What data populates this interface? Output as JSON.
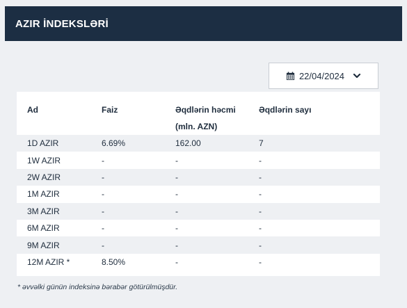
{
  "header": {
    "title": "AZIR İNDEKSLƏRİ"
  },
  "date_picker": {
    "value": "22/04/2024",
    "calendar_icon": "calendar-icon",
    "chevron_icon": "chevron-down-icon"
  },
  "table": {
    "columns": [
      "Ad",
      "Faiz",
      "Əqdlərin həcmi (mln. AZN)",
      "Əqdlərin sayı"
    ],
    "rows": [
      [
        "1D AZIR",
        "6.69%",
        "162.00",
        "7"
      ],
      [
        "1W AZIR",
        "-",
        "-",
        "-"
      ],
      [
        "2W AZIR",
        "-",
        "-",
        "-"
      ],
      [
        "1M AZIR",
        "-",
        "-",
        "-"
      ],
      [
        "3M AZIR",
        "-",
        "-",
        "-"
      ],
      [
        "6M AZIR",
        "-",
        "-",
        "-"
      ],
      [
        "9M AZIR",
        "-",
        "-",
        "-"
      ],
      [
        "12M AZIR *",
        "8.50%",
        "-",
        "-"
      ]
    ]
  },
  "footnote": "* əvvəlki günün indeksinə bərabər götürülmüşdür.",
  "colors": {
    "header_bg": "#1c2e43",
    "page_bg": "#eef0f3",
    "stripe": "#eef0f3"
  }
}
